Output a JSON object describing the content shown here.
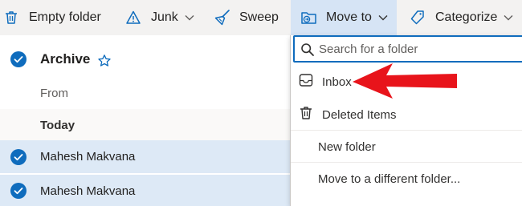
{
  "toolbar": {
    "empty_folder": {
      "label": "Empty folder",
      "icon": "trash-icon"
    },
    "junk": {
      "label": "Junk",
      "icon": "warning-icon"
    },
    "sweep": {
      "label": "Sweep",
      "icon": "broom-icon"
    },
    "move_to": {
      "label": "Move to",
      "icon": "folder-move-icon"
    },
    "categorize": {
      "label": "Categorize",
      "icon": "tag-icon"
    }
  },
  "message_list": {
    "folder_title": "Archive",
    "from_label": "From",
    "group_label": "Today",
    "messages": [
      {
        "sender": "Mahesh Makvana",
        "selected": true
      },
      {
        "sender": "Mahesh Makvana",
        "selected": true
      }
    ]
  },
  "move_menu": {
    "search_placeholder": "Search for a folder",
    "items": [
      {
        "label": "Inbox",
        "icon": "inbox-icon"
      },
      {
        "label": "Deleted Items",
        "icon": "trash-icon"
      },
      {
        "label": "New folder"
      },
      {
        "label": "Move to a different folder..."
      }
    ]
  },
  "colors": {
    "accent": "#0f6cbd",
    "selected_row": "#dde9f6",
    "active_button": "#d6e4f5",
    "annotation_arrow": "#e8141b"
  }
}
